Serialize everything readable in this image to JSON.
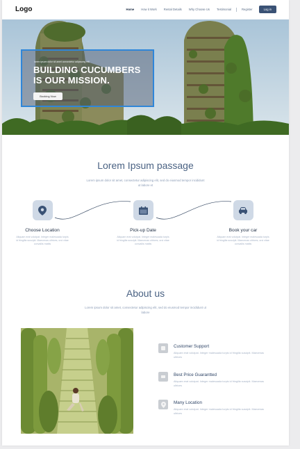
{
  "nav": {
    "logo": "Logo",
    "links": [
      "Home",
      "How it Work",
      "Rental Details",
      "Why Choose Us",
      "Testimonial",
      "Register"
    ],
    "login": "Log in"
  },
  "hero": {
    "kicker": "lorem ipsum dolor sit amet consectetur adipiscing elit",
    "title_line1": "BUILDING CUCUMBERS",
    "title_line2": "IS OUR MISSION.",
    "button": "Booking Now"
  },
  "how": {
    "title": "Lorem Ipsum passage",
    "subtitle": "Lorem ipsum dolor sit amet, consectetur adipiscing elit, sed do eiusmod tempor incididunt ut labore et",
    "steps": [
      {
        "icon": "location-pin-icon",
        "title": "Choose Location",
        "desc": "Aliquam erat volutpat. Integer malesuada turpis id fringilla suscipit. Maecenas ultrices, orci vitae convallis mattis"
      },
      {
        "icon": "calendar-icon",
        "title": "Pick-up Date",
        "desc": "Aliquam erat volutpat. Integer malesuada turpis id fringilla suscipit. Maecenas ultrices, orci vitae convallis mattis"
      },
      {
        "icon": "car-icon",
        "title": "Book your car",
        "desc": "Aliquam erat volutpat. Integer malesuada turpis id fringilla suscipit. Maecenas ultrices, orci vitae convallis mattis"
      }
    ]
  },
  "about": {
    "title": "About us",
    "subtitle": "Lorem ipsum dolor sit amet, consectetur adipiscing elit, sed do eiusmod tempor incididunt ut labore",
    "features": [
      {
        "icon": "headset-icon",
        "title": "Customer Support",
        "desc": "Aliquam erat volutpat. Integer malesuada turpis id fringilla suscipit. Maecenas ultrices"
      },
      {
        "icon": "price-tag-icon",
        "title": "Best Price Guarantted",
        "desc": "Aliquam erat volutpat. Integer malesuada turpis id fringilla suscipit. Maecenas ultrices"
      },
      {
        "icon": "map-pin-icon",
        "title": "Many Location",
        "desc": "Aliquam erat volutpat. Integer malesuada turpis id fringilla suscipit. Maecenas ultrices"
      }
    ]
  },
  "colors": {
    "accent": "#3a5275",
    "hero_box_border": "#2f86d9",
    "icon_bg": "#cfd9e6"
  }
}
